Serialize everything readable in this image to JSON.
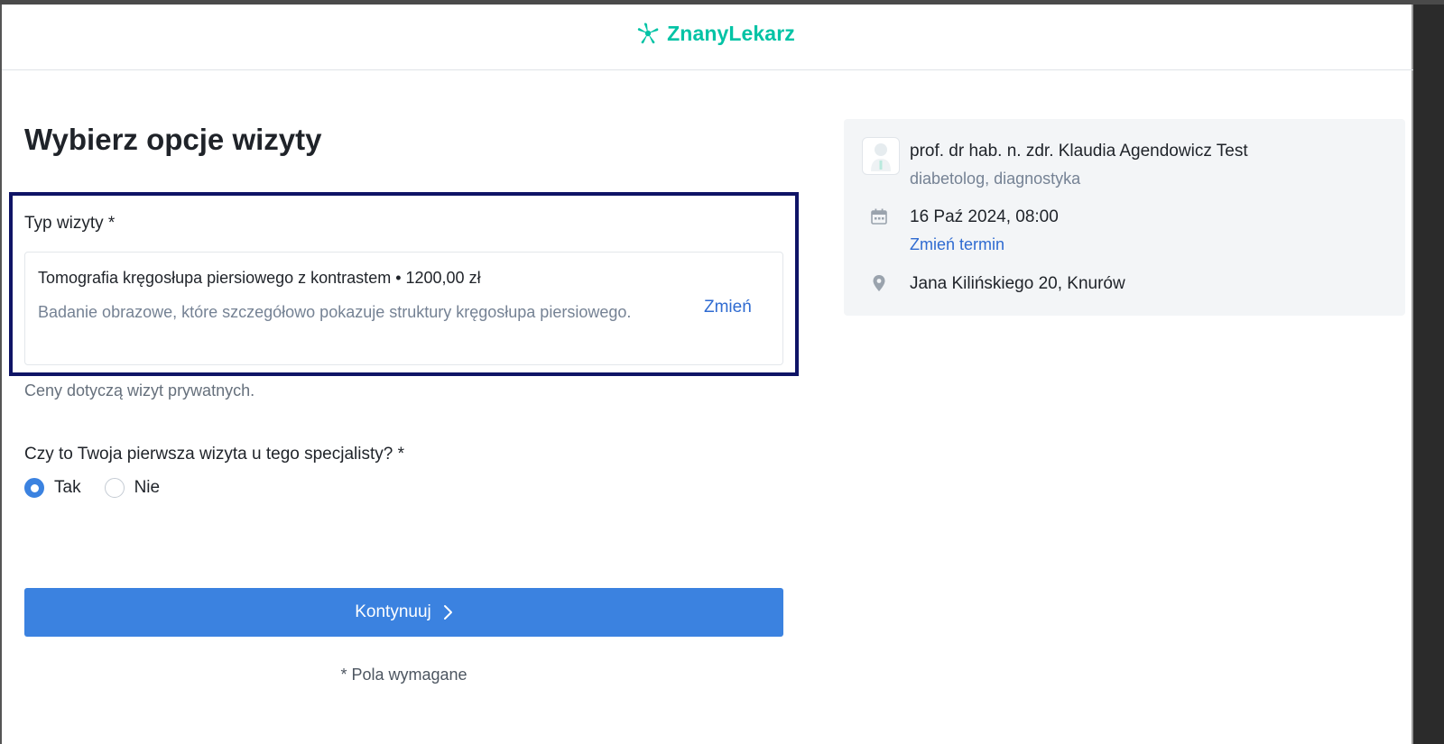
{
  "header": {
    "logo_text": "ZnanyLekarz",
    "logo_color": "#00c3a5"
  },
  "form": {
    "title": "Wybierz opcje wizyty",
    "visit_type_label": "Typ wizyty *",
    "visit": {
      "title": "Tomografia kręgosłupa piersiowego z kontrastem • 1200,00 zł",
      "description": "Badanie obrazowe, które szczegółowo pokazuje struktury kręgosłupa piersiowego.",
      "change_label": "Zmień"
    },
    "price_note": "Ceny dotyczą wizyt prywatnych.",
    "first_visit_question": "Czy to Twoja pierwsza wizyta u tego specjalisty? *",
    "options": [
      {
        "label": "Tak",
        "selected": true
      },
      {
        "label": "Nie",
        "selected": false
      }
    ],
    "continue_label": "Kontynuuj",
    "required_note": "* Pola wymagane"
  },
  "summary": {
    "doctor_name": "prof. dr hab. n. zdr. Klaudia Agendowicz Test",
    "specialization": "diabetolog, diagnostyka",
    "date": "16 Paź 2024, 08:00",
    "change_term_label": "Zmień termin",
    "address": "Jana Kilińskiego 20, Knurów"
  },
  "colors": {
    "primary_button": "#3b82e0",
    "link": "#2f6bd1",
    "highlight_border": "#0f1466",
    "summary_background": "#f3f5f7"
  },
  "icons": {
    "logo": "znanylekarz-star-icon",
    "continue": "chevron-right-icon",
    "date": "calendar-icon",
    "address": "map-pin-icon",
    "avatar": "doctor-avatar-icon"
  }
}
